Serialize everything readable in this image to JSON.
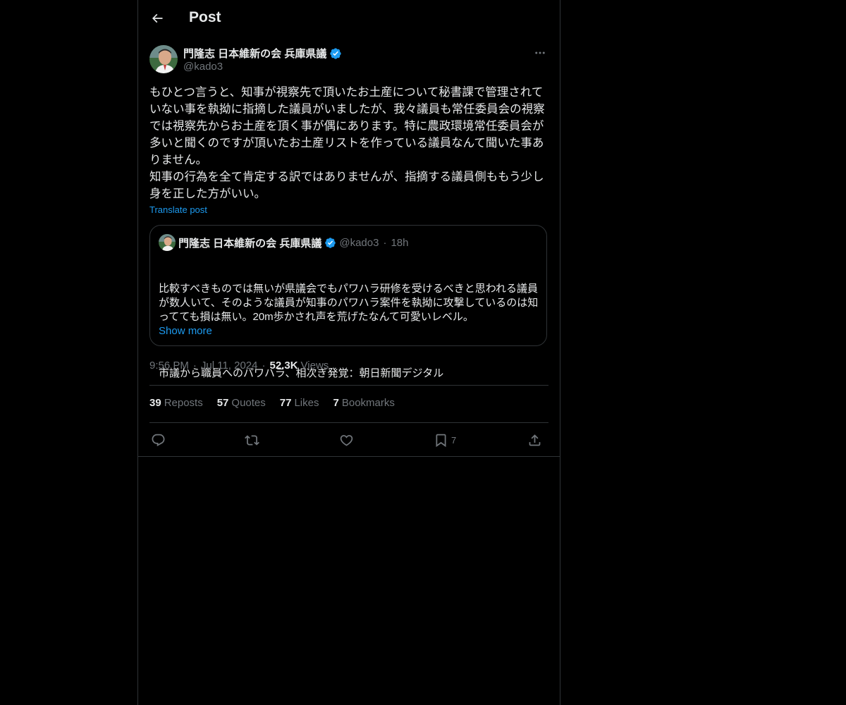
{
  "header": {
    "title": "Post"
  },
  "author": {
    "display_name": "門隆志 日本維新の会 兵庫県議",
    "handle": "@kado3"
  },
  "post": {
    "text": "もひとつ言うと、知事が視察先で頂いたお土産について秘書課で管理されていない事を執拗に指摘した議員がいましたが、我々議員も常任委員会の視察では視察先からお土産を頂く事が偶にあります。特に農政環境常任委員会が多いと聞くのですが頂いたお土産リストを作っている議員なんて聞いた事ありません。\n知事の行為を全て肯定する訳ではありませんが、指摘する議員側ももう少し身を正した方がいい。",
    "translate_label": "Translate post"
  },
  "quote": {
    "display_name": "門隆志 日本維新の会 兵庫県議",
    "handle": "@kado3",
    "separator": "·",
    "time": "18h",
    "text": "比較すべきものでは無いが県議会でもパワハラ研修を受けるべきと思われる議員が数人いて、そのような議員が知事のパワハラ案件を執拗に攻撃しているのは知ってても損は無い。20m歩かされ声を荒げたなんて可愛いレベル。",
    "link_text": "市議から職員へのパワハラ、相次ぎ発覚：朝日新聞デジタル",
    "show_more": "Show more"
  },
  "meta": {
    "time": "9:56 PM",
    "dot1": "·",
    "date": "Jul 11, 2024",
    "dot2": "·",
    "views_count": "52.3K",
    "views_label": "Views"
  },
  "stats": [
    {
      "num": "39",
      "label": "Reposts"
    },
    {
      "num": "57",
      "label": "Quotes"
    },
    {
      "num": "77",
      "label": "Likes"
    },
    {
      "num": "7",
      "label": "Bookmarks"
    }
  ],
  "actions": {
    "bookmark_count": "7"
  },
  "icons": {
    "back": "back-arrow-icon",
    "more": "more-dots-icon",
    "verified": "verified-badge-icon",
    "reply": "reply-icon",
    "repost": "repost-icon",
    "like": "heart-icon",
    "bookmark": "bookmark-icon",
    "share": "share-icon"
  },
  "colors": {
    "background": "#000000",
    "text": "#e7e9ea",
    "muted": "#71767b",
    "accent": "#1d9bf0",
    "border": "#2f3336"
  }
}
